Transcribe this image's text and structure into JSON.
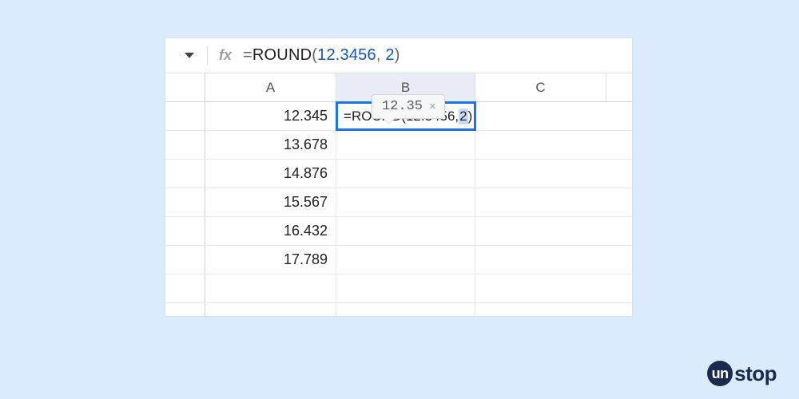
{
  "formula_bar": {
    "fx_label": "fx",
    "prefix": "=",
    "fn": "ROUND",
    "open": "(",
    "arg1": "12.3456",
    "comma": ",",
    "space": " ",
    "arg2": "2",
    "close": ")"
  },
  "columns": {
    "A": "A",
    "B": "B",
    "C": "C"
  },
  "rows": {
    "a_values": [
      "12.345",
      "13.678",
      "14.876",
      "15.567",
      "16.432",
      "17.789"
    ]
  },
  "editing_cell": {
    "prefix": "=",
    "fn": "ROUND",
    "open": "(",
    "arg1": "12.3456",
    "comma": ",",
    "space": " ",
    "arg2": "2",
    "close": ")"
  },
  "preview": {
    "value": "12.35",
    "close": "×"
  },
  "brand": {
    "initial": "un",
    "rest": "stop"
  }
}
